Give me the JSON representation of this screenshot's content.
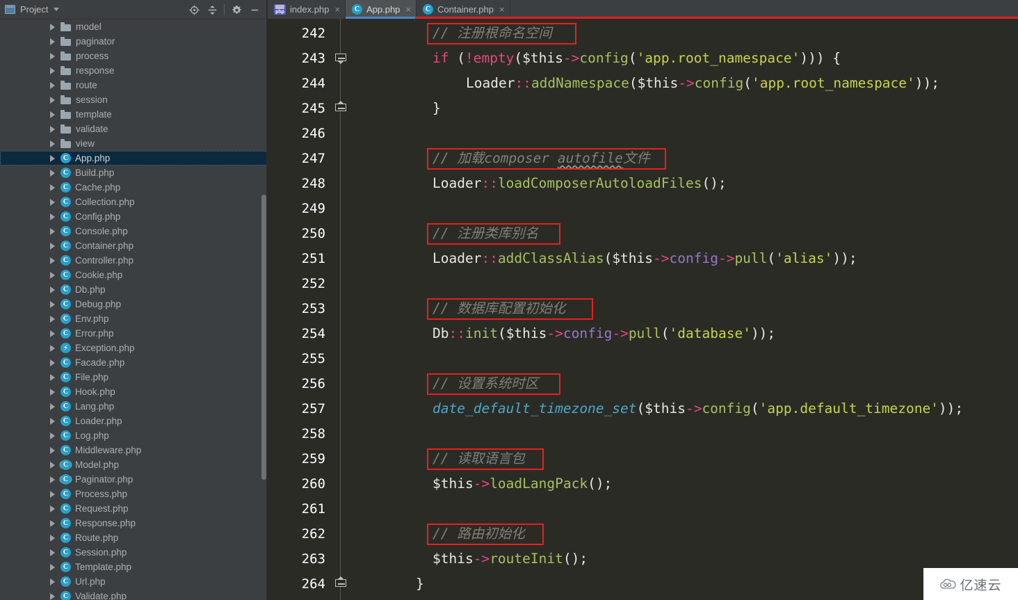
{
  "sidebar": {
    "title": "Project",
    "title_icon": "project-window-icon",
    "caret_icon": "chevron-down-icon",
    "tools": [
      {
        "name": "locate-icon",
        "glyph": "⊕"
      },
      {
        "name": "collapse-all-icon",
        "glyph": "≡"
      },
      {
        "name": "gear-icon",
        "glyph": "⚙"
      },
      {
        "name": "minimize-icon",
        "glyph": "—"
      }
    ],
    "items": [
      {
        "label": "model",
        "kind": "folder",
        "selected": false
      },
      {
        "label": "paginator",
        "kind": "folder",
        "selected": false
      },
      {
        "label": "process",
        "kind": "folder",
        "selected": false
      },
      {
        "label": "response",
        "kind": "folder",
        "selected": false
      },
      {
        "label": "route",
        "kind": "folder",
        "selected": false
      },
      {
        "label": "session",
        "kind": "folder",
        "selected": false
      },
      {
        "label": "template",
        "kind": "folder",
        "selected": false
      },
      {
        "label": "validate",
        "kind": "folder",
        "selected": false
      },
      {
        "label": "view",
        "kind": "folder",
        "selected": false
      },
      {
        "label": "App.php",
        "kind": "class",
        "selected": true
      },
      {
        "label": "Build.php",
        "kind": "class",
        "selected": false
      },
      {
        "label": "Cache.php",
        "kind": "class",
        "selected": false
      },
      {
        "label": "Collection.php",
        "kind": "class",
        "selected": false
      },
      {
        "label": "Config.php",
        "kind": "class",
        "selected": false
      },
      {
        "label": "Console.php",
        "kind": "class",
        "selected": false
      },
      {
        "label": "Container.php",
        "kind": "class",
        "selected": false
      },
      {
        "label": "Controller.php",
        "kind": "class",
        "selected": false
      },
      {
        "label": "Cookie.php",
        "kind": "class",
        "selected": false
      },
      {
        "label": "Db.php",
        "kind": "class",
        "selected": false
      },
      {
        "label": "Debug.php",
        "kind": "class",
        "selected": false
      },
      {
        "label": "Env.php",
        "kind": "class",
        "selected": false
      },
      {
        "label": "Error.php",
        "kind": "class",
        "selected": false
      },
      {
        "label": "Exception.php",
        "kind": "exception",
        "selected": false
      },
      {
        "label": "Facade.php",
        "kind": "class",
        "selected": false
      },
      {
        "label": "File.php",
        "kind": "class",
        "selected": false
      },
      {
        "label": "Hook.php",
        "kind": "class",
        "selected": false
      },
      {
        "label": "Lang.php",
        "kind": "class",
        "selected": false
      },
      {
        "label": "Loader.php",
        "kind": "class",
        "selected": false
      },
      {
        "label": "Log.php",
        "kind": "class",
        "selected": false
      },
      {
        "label": "Middleware.php",
        "kind": "class",
        "selected": false
      },
      {
        "label": "Model.php",
        "kind": "abstract",
        "selected": false
      },
      {
        "label": "Paginator.php",
        "kind": "abstract",
        "selected": false
      },
      {
        "label": "Process.php",
        "kind": "class",
        "selected": false
      },
      {
        "label": "Request.php",
        "kind": "class",
        "selected": false
      },
      {
        "label": "Response.php",
        "kind": "class",
        "selected": false
      },
      {
        "label": "Route.php",
        "kind": "class",
        "selected": false
      },
      {
        "label": "Session.php",
        "kind": "class",
        "selected": false
      },
      {
        "label": "Template.php",
        "kind": "class",
        "selected": false
      },
      {
        "label": "Url.php",
        "kind": "class",
        "selected": false
      },
      {
        "label": "Validate.php",
        "kind": "class",
        "selected": false
      }
    ]
  },
  "tabs": [
    {
      "label": "index.php",
      "kind": "php",
      "active": false,
      "close_glyph": "×"
    },
    {
      "label": "App.php",
      "kind": "class",
      "active": true,
      "close_glyph": "×"
    },
    {
      "label": "Container.php",
      "kind": "class",
      "active": false,
      "close_glyph": "×"
    }
  ],
  "editor": {
    "first_line_number": 242,
    "line_numbers": [
      242,
      243,
      244,
      245,
      246,
      247,
      248,
      249,
      250,
      251,
      252,
      253,
      254,
      255,
      256,
      257,
      258,
      259,
      260,
      261,
      262,
      263,
      264
    ],
    "fold_markers": [
      {
        "line": 243,
        "direction": "down"
      },
      {
        "line": 245,
        "direction": "up"
      },
      {
        "line": 264,
        "direction": "up"
      }
    ],
    "lines": [
      {
        "n": 242,
        "indent": 2,
        "tokens": [
          {
            "t": "// 注册根命名空间",
            "c": "cmt"
          }
        ],
        "annotated": true
      },
      {
        "n": 243,
        "indent": 2,
        "tokens": [
          {
            "t": "if",
            "c": "kw2"
          },
          {
            "t": " (",
            "c": "plain"
          },
          {
            "t": "!",
            "c": "kw2"
          },
          {
            "t": "empty",
            "c": "kw2"
          },
          {
            "t": "(",
            "c": "plain"
          },
          {
            "t": "$this",
            "c": "plain"
          },
          {
            "t": "->",
            "c": "op"
          },
          {
            "t": "config",
            "c": "meth"
          },
          {
            "t": "(",
            "c": "plain"
          },
          {
            "t": "'app.root_namespace'",
            "c": "str"
          },
          {
            "t": "))) {",
            "c": "plain"
          }
        ],
        "annotated": false
      },
      {
        "n": 244,
        "indent": 4,
        "tokens": [
          {
            "t": "Loader",
            "c": "plain"
          },
          {
            "t": "::",
            "c": "op"
          },
          {
            "t": "addNamespace",
            "c": "meth"
          },
          {
            "t": "(",
            "c": "plain"
          },
          {
            "t": "$this",
            "c": "plain"
          },
          {
            "t": "->",
            "c": "op"
          },
          {
            "t": "config",
            "c": "meth"
          },
          {
            "t": "(",
            "c": "plain"
          },
          {
            "t": "'app.root_namespace'",
            "c": "str"
          },
          {
            "t": "));",
            "c": "plain"
          }
        ],
        "annotated": false
      },
      {
        "n": 245,
        "indent": 2,
        "tokens": [
          {
            "t": "}",
            "c": "plain"
          }
        ],
        "annotated": false
      },
      {
        "n": 246,
        "indent": 2,
        "tokens": [],
        "annotated": false
      },
      {
        "n": 247,
        "indent": 2,
        "tokens": [
          {
            "t": "// 加载composer ",
            "c": "cmt"
          },
          {
            "t": "autofile",
            "c": "cmt squiggle"
          },
          {
            "t": "文件",
            "c": "cmt"
          }
        ],
        "annotated": true
      },
      {
        "n": 248,
        "indent": 2,
        "tokens": [
          {
            "t": "Loader",
            "c": "plain"
          },
          {
            "t": "::",
            "c": "op"
          },
          {
            "t": "loadComposerAutoloadFiles",
            "c": "meth"
          },
          {
            "t": "();",
            "c": "plain"
          }
        ],
        "annotated": false
      },
      {
        "n": 249,
        "indent": 2,
        "tokens": [],
        "annotated": false
      },
      {
        "n": 250,
        "indent": 2,
        "tokens": [
          {
            "t": "// 注册类库别名",
            "c": "cmt"
          }
        ],
        "annotated": true
      },
      {
        "n": 251,
        "indent": 2,
        "tokens": [
          {
            "t": "Loader",
            "c": "plain"
          },
          {
            "t": "::",
            "c": "op"
          },
          {
            "t": "addClassAlias",
            "c": "meth"
          },
          {
            "t": "(",
            "c": "plain"
          },
          {
            "t": "$this",
            "c": "plain"
          },
          {
            "t": "->",
            "c": "op"
          },
          {
            "t": "config",
            "c": "prop"
          },
          {
            "t": "->",
            "c": "op"
          },
          {
            "t": "pull",
            "c": "meth"
          },
          {
            "t": "(",
            "c": "plain"
          },
          {
            "t": "'alias'",
            "c": "str"
          },
          {
            "t": "));",
            "c": "plain"
          }
        ],
        "annotated": false
      },
      {
        "n": 252,
        "indent": 2,
        "tokens": [],
        "annotated": false
      },
      {
        "n": 253,
        "indent": 2,
        "tokens": [
          {
            "t": "// 数据库配置初始化",
            "c": "cmt"
          }
        ],
        "annotated": true
      },
      {
        "n": 254,
        "indent": 2,
        "tokens": [
          {
            "t": "Db",
            "c": "plain"
          },
          {
            "t": "::",
            "c": "op"
          },
          {
            "t": "init",
            "c": "meth"
          },
          {
            "t": "(",
            "c": "plain"
          },
          {
            "t": "$this",
            "c": "plain"
          },
          {
            "t": "->",
            "c": "op"
          },
          {
            "t": "config",
            "c": "prop"
          },
          {
            "t": "->",
            "c": "op"
          },
          {
            "t": "pull",
            "c": "meth"
          },
          {
            "t": "(",
            "c": "plain"
          },
          {
            "t": "'database'",
            "c": "str"
          },
          {
            "t": "));",
            "c": "plain"
          }
        ],
        "annotated": false
      },
      {
        "n": 255,
        "indent": 2,
        "tokens": [],
        "annotated": false
      },
      {
        "n": 256,
        "indent": 2,
        "tokens": [
          {
            "t": "// 设置系统时区",
            "c": "cmt"
          }
        ],
        "annotated": true
      },
      {
        "n": 257,
        "indent": 2,
        "tokens": [
          {
            "t": "date_default_timezone_set",
            "c": "fn"
          },
          {
            "t": "(",
            "c": "plain"
          },
          {
            "t": "$this",
            "c": "plain"
          },
          {
            "t": "->",
            "c": "op"
          },
          {
            "t": "config",
            "c": "meth"
          },
          {
            "t": "(",
            "c": "plain"
          },
          {
            "t": "'app.default_timezone'",
            "c": "str"
          },
          {
            "t": "));",
            "c": "plain"
          }
        ],
        "annotated": false
      },
      {
        "n": 258,
        "indent": 2,
        "tokens": [],
        "annotated": false
      },
      {
        "n": 259,
        "indent": 2,
        "tokens": [
          {
            "t": "// 读取语言包",
            "c": "cmt"
          }
        ],
        "annotated": true
      },
      {
        "n": 260,
        "indent": 2,
        "tokens": [
          {
            "t": "$this",
            "c": "plain"
          },
          {
            "t": "->",
            "c": "op"
          },
          {
            "t": "loadLangPack",
            "c": "meth"
          },
          {
            "t": "();",
            "c": "plain"
          }
        ],
        "annotated": false
      },
      {
        "n": 261,
        "indent": 2,
        "tokens": [],
        "annotated": false
      },
      {
        "n": 262,
        "indent": 2,
        "tokens": [
          {
            "t": "// 路由初始化",
            "c": "cmt"
          }
        ],
        "annotated": true
      },
      {
        "n": 263,
        "indent": 2,
        "tokens": [
          {
            "t": "$this",
            "c": "plain"
          },
          {
            "t": "->",
            "c": "op"
          },
          {
            "t": "routeInit",
            "c": "meth"
          },
          {
            "t": "();",
            "c": "plain"
          }
        ],
        "annotated": false
      },
      {
        "n": 264,
        "indent": 1,
        "tokens": [
          {
            "t": "}",
            "c": "plain"
          }
        ],
        "annotated": false
      }
    ]
  },
  "watermark": {
    "text": "亿速云",
    "icon": "cloud-icon"
  },
  "colors": {
    "editor_bg": "#2b2b26",
    "sidebar_bg": "#3c3f41",
    "selection_bg": "#0d293e",
    "annotation_red": "#e8201c",
    "tab_accent": "#4a88c7",
    "class_icon": "#279fca"
  }
}
